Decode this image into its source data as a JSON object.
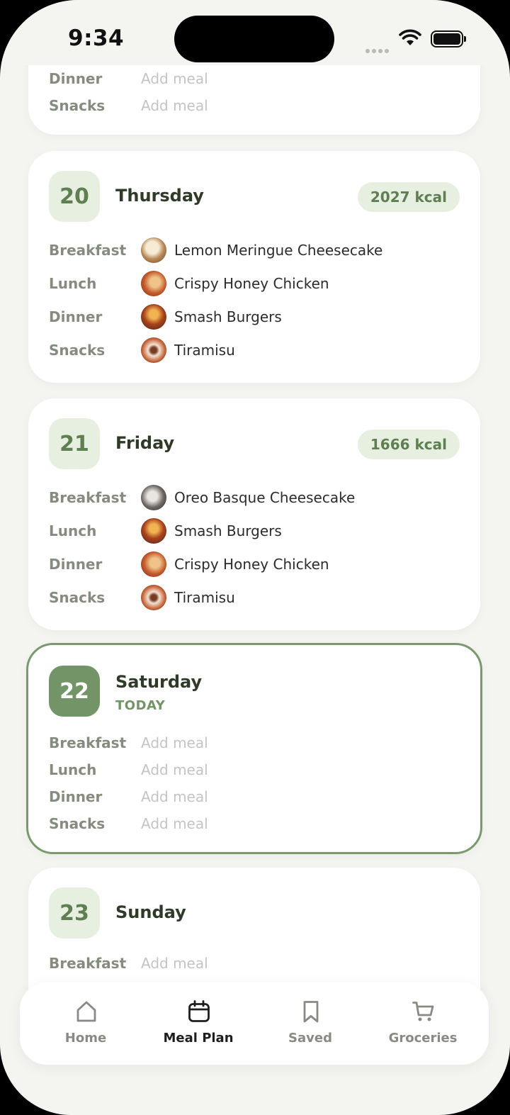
{
  "status": {
    "time": "9:34"
  },
  "partial_card": {
    "rows": [
      {
        "label": "Dinner",
        "meal": "Add meal"
      },
      {
        "label": "Snacks",
        "meal": "Add meal"
      }
    ]
  },
  "days": [
    {
      "date": "20",
      "name": "Thursday",
      "kcal": "2027 kcal",
      "meals": [
        {
          "label": "Breakfast",
          "meal": "Lemon Meringue Cheesecake",
          "thumb": "cheesecake"
        },
        {
          "label": "Lunch",
          "meal": "Crispy Honey Chicken",
          "thumb": "chicken"
        },
        {
          "label": "Dinner",
          "meal": "Smash Burgers",
          "thumb": "burger"
        },
        {
          "label": "Snacks",
          "meal": "Tiramisu",
          "thumb": "tiramisu"
        }
      ]
    },
    {
      "date": "21",
      "name": "Friday",
      "kcal": "1666 kcal",
      "meals": [
        {
          "label": "Breakfast",
          "meal": "Oreo Basque Cheesecake",
          "thumb": "oreo"
        },
        {
          "label": "Lunch",
          "meal": "Smash Burgers",
          "thumb": "burger"
        },
        {
          "label": "Dinner",
          "meal": "Crispy Honey Chicken",
          "thumb": "chicken"
        },
        {
          "label": "Snacks",
          "meal": "Tiramisu",
          "thumb": "tiramisu"
        }
      ]
    },
    {
      "date": "22",
      "name": "Saturday",
      "tag": "TODAY",
      "meals": [
        {
          "label": "Breakfast",
          "meal": "Add meal"
        },
        {
          "label": "Lunch",
          "meal": "Add meal"
        },
        {
          "label": "Dinner",
          "meal": "Add meal"
        },
        {
          "label": "Snacks",
          "meal": "Add meal"
        }
      ]
    },
    {
      "date": "23",
      "name": "Sunday",
      "meals": [
        {
          "label": "Breakfast",
          "meal": "Add meal"
        }
      ]
    }
  ],
  "tabbar": {
    "items": [
      {
        "label": "Home",
        "icon": "home-icon"
      },
      {
        "label": "Meal Plan",
        "icon": "calendar-icon",
        "active": true
      },
      {
        "label": "Saved",
        "icon": "bookmark-icon"
      },
      {
        "label": "Groceries",
        "icon": "cart-icon"
      }
    ]
  },
  "colors": {
    "accent": "#739466",
    "accent_light": "#e6efe0",
    "background": "#f4f4f1"
  }
}
